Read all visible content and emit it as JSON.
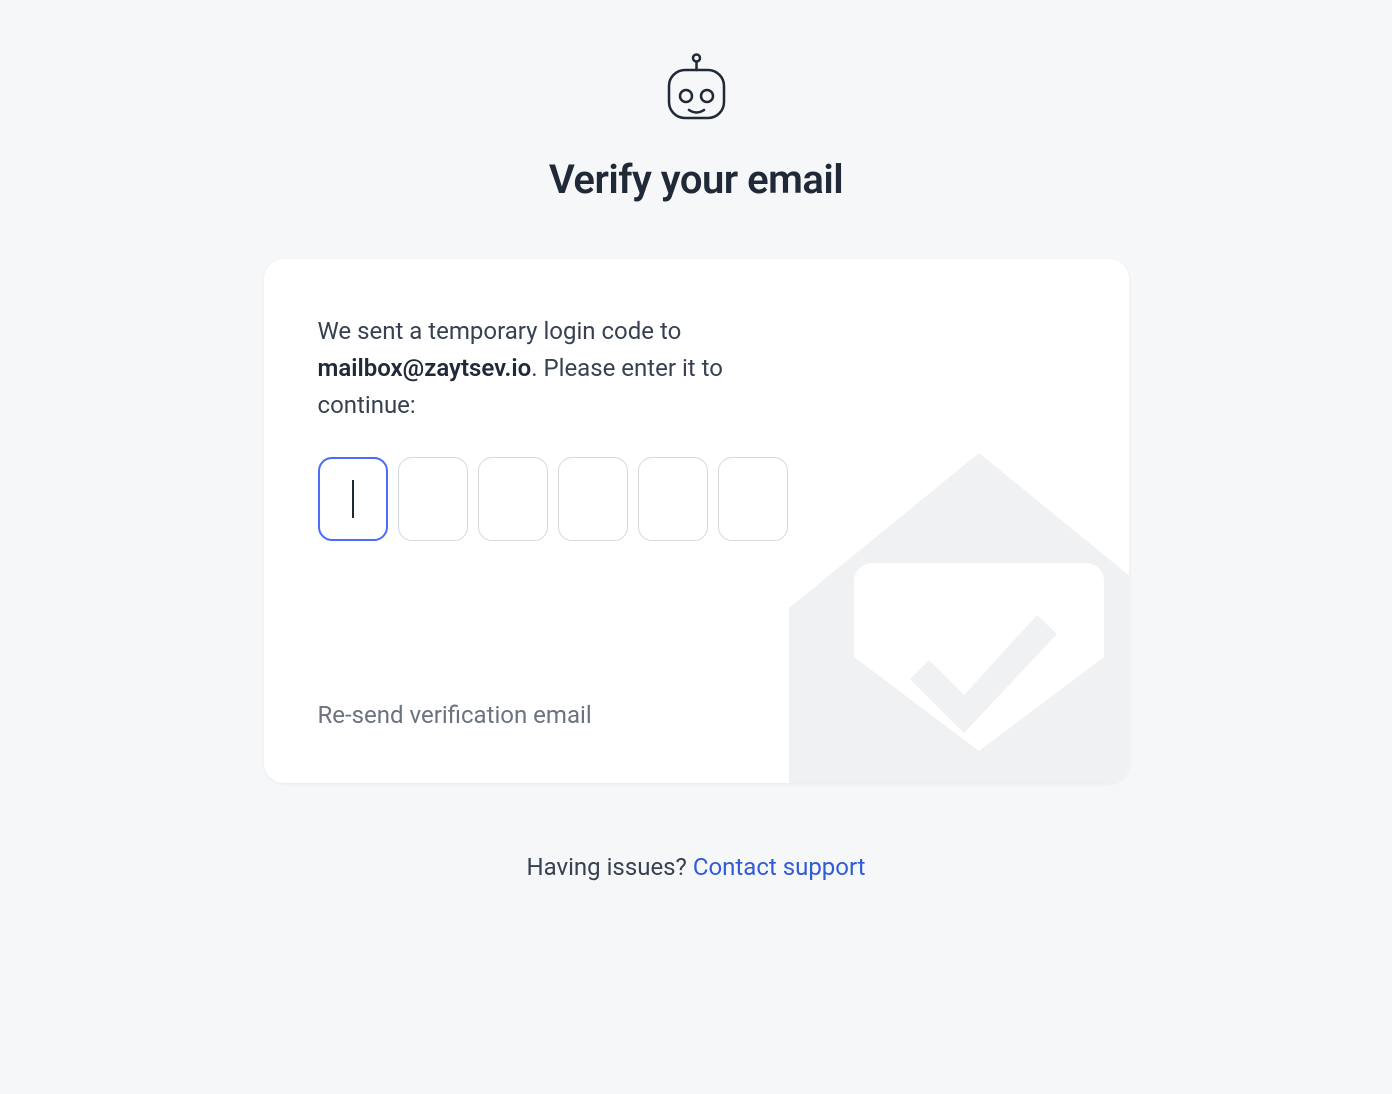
{
  "header": {
    "title": "Verify your email"
  },
  "card": {
    "message_prefix": "We sent a temporary login code to ",
    "email": "mailbox@zaytsev.io",
    "message_suffix": ". Please enter it to continue:",
    "code_digits": [
      "",
      "",
      "",
      "",
      "",
      ""
    ],
    "resend_label": "Re-send verification email"
  },
  "footer": {
    "issues_text": "Having issues? ",
    "support_link_text": "Contact support"
  }
}
